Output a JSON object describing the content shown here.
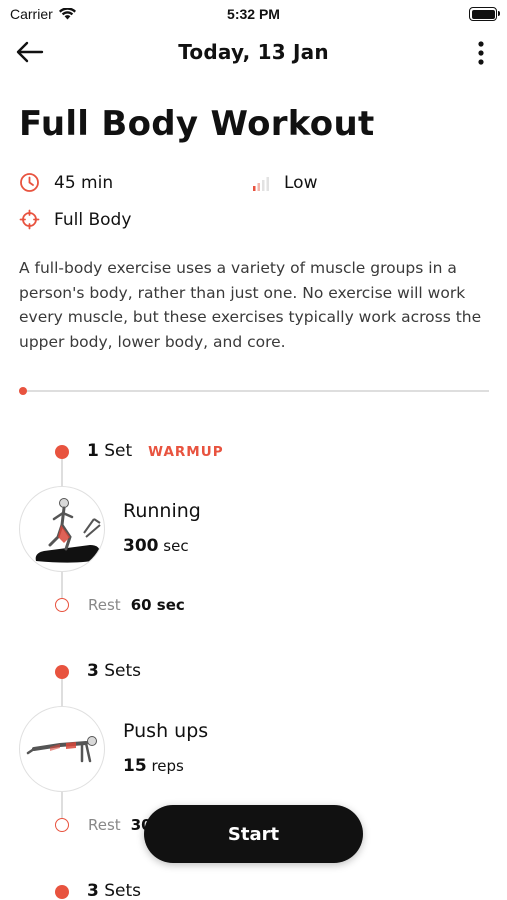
{
  "status_bar": {
    "carrier": "Carrier",
    "time": "5:32 PM"
  },
  "nav": {
    "title": "Today, 13 Jan",
    "back_icon": "arrow-left-icon",
    "more_icon": "more-vertical-icon"
  },
  "workout": {
    "title": "Full Body Workout",
    "duration": "45 min",
    "intensity": "Low",
    "focus": "Full Body",
    "description": "A full-body exercise uses a variety of muscle groups in a person's body, rather than just one. No exercise will work every muscle, but these exercises typically work across the upper body, lower body, and core."
  },
  "accent_color": "#e8533f",
  "exercises": [
    {
      "sets_count": "1",
      "sets_word": "Set",
      "tag": "WARMUP",
      "name": "Running",
      "value": "300",
      "unit": "sec",
      "rest_label": "Rest",
      "rest_value": "60 sec"
    },
    {
      "sets_count": "3",
      "sets_word": "Sets",
      "tag": "",
      "name": "Push ups",
      "value": "15",
      "unit": "reps",
      "rest_label": "Rest",
      "rest_value": "30 sec"
    },
    {
      "sets_count": "3",
      "sets_word": "Sets",
      "tag": ""
    }
  ],
  "start_button": {
    "label": "Start"
  }
}
